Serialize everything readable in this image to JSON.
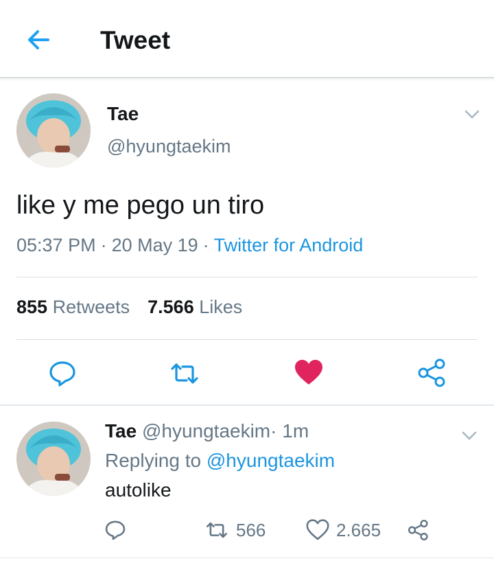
{
  "header": {
    "title": "Tweet",
    "back_icon": "arrow-left-icon",
    "accent": "#1da1f2"
  },
  "tweet": {
    "author_name": "Tae",
    "author_handle": "@hyungtaekim",
    "text": "like y me pego un tiro",
    "time": "05:37 PM",
    "date": "20 May 19",
    "separator": "·",
    "source": "Twitter for Android",
    "retweet_count": "855",
    "retweet_label": "Retweets",
    "like_count": "7.566",
    "like_label": "Likes",
    "liked": true,
    "like_color": "#e0245e",
    "actions": [
      "reply-icon",
      "retweet-icon",
      "heart-filled-icon",
      "share-icon"
    ]
  },
  "reply": {
    "author_name": "Tae",
    "author_handle": "@hyungtaekim",
    "separator": "·",
    "time": "1m",
    "replying_prefix": "Replying to",
    "replying_to": "@hyungtaekim",
    "text": "autolike",
    "retweet_count": "566",
    "like_count": "2.665",
    "actions": [
      "reply-icon",
      "retweet-icon",
      "heart-outline-icon",
      "share-icon"
    ]
  }
}
